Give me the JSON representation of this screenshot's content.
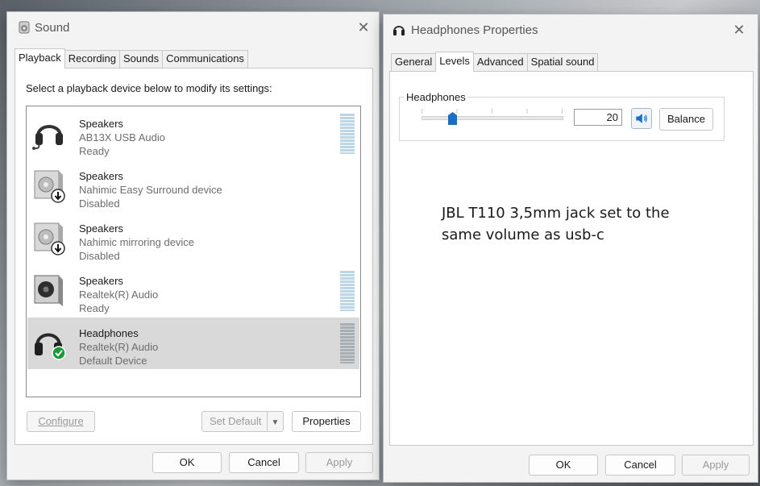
{
  "sound": {
    "title": "Sound",
    "tabs": [
      "Playback",
      "Recording",
      "Sounds",
      "Communications"
    ],
    "instruction": "Select a playback device below to modify its settings:",
    "devices": [
      {
        "name": "Speakers",
        "desc": "AB13X USB Audio",
        "status": "Ready",
        "icon": "headset-icon"
      },
      {
        "name": "Speakers",
        "desc": "Nahimic Easy Surround device",
        "status": "Disabled",
        "icon": "speaker-disabled-icon"
      },
      {
        "name": "Speakers",
        "desc": "Nahimic mirroring device",
        "status": "Disabled",
        "icon": "speaker-disabled-icon"
      },
      {
        "name": "Speakers",
        "desc": "Realtek(R) Audio",
        "status": "Ready",
        "icon": "speaker-icon"
      },
      {
        "name": "Headphones",
        "desc": "Realtek(R) Audio",
        "status": "Default Device",
        "icon": "headphones-default-icon"
      }
    ],
    "configure": "Configure",
    "set_default": "Set Default",
    "properties": "Properties",
    "ok": "OK",
    "cancel": "Cancel",
    "apply": "Apply"
  },
  "props": {
    "title": "Headphones Properties",
    "tabs": [
      "General",
      "Levels",
      "Advanced",
      "Spatial sound"
    ],
    "level_label": "Headphones",
    "level_value": "20",
    "level_fraction": 0.2,
    "balance": "Balance",
    "note_line1": "JBL T110 3,5mm jack set to the",
    "note_line2": "same volume as usb-c",
    "ok": "OK",
    "cancel": "Cancel",
    "apply": "Apply"
  }
}
